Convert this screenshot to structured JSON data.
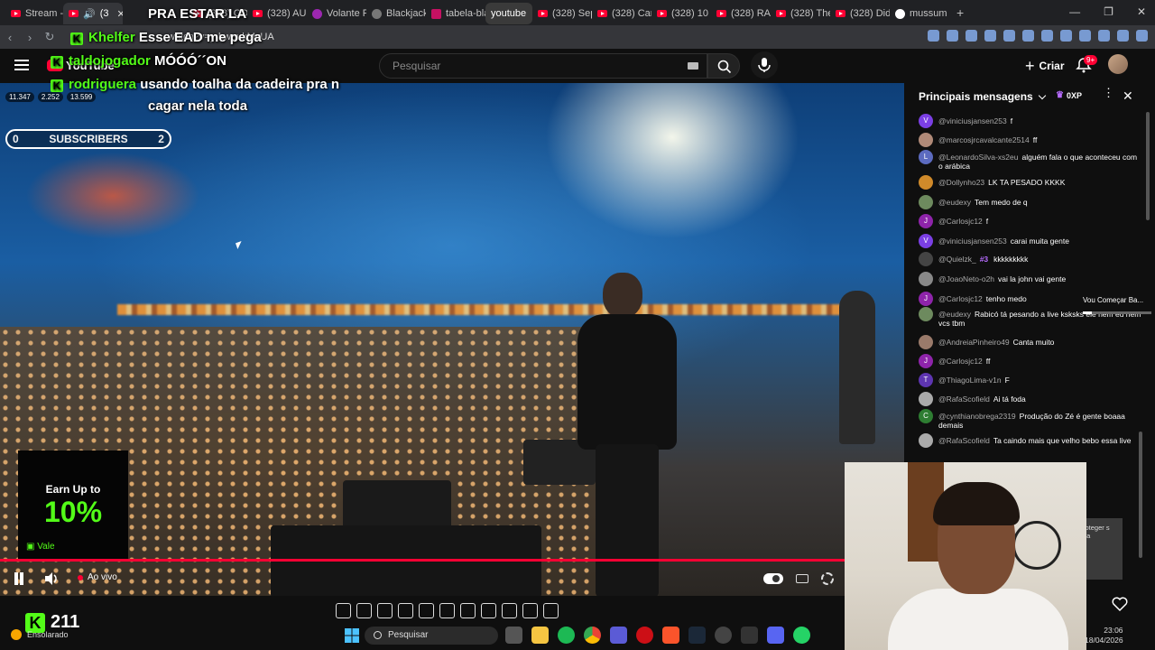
{
  "browser": {
    "tabs": [
      {
        "label": "Stream - K",
        "icon": "youtube-icon"
      },
      {
        "label": "(3",
        "icon": "youtube-icon",
        "active": true
      },
      {
        "label": "(328) CON",
        "icon": "youtube-icon"
      },
      {
        "label": "(328) AU",
        "icon": "youtube-icon"
      },
      {
        "label": "Volante F",
        "icon": "volante-icon"
      },
      {
        "label": "Blackjack",
        "icon": "blackjack-icon"
      },
      {
        "label": "tabela-bla",
        "icon": "doc-icon"
      },
      {
        "label": "youtube",
        "icon": "youtube-icon"
      },
      {
        "label": "(328) Sep",
        "icon": "youtube-icon"
      },
      {
        "label": "(328) Can",
        "icon": "youtube-icon"
      },
      {
        "label": "(328) 10 C",
        "icon": "youtube-icon"
      },
      {
        "label": "(328) RA",
        "icon": "youtube-icon"
      },
      {
        "label": "(328) The",
        "icon": "youtube-icon"
      },
      {
        "label": "(328) Did",
        "icon": "youtube-icon"
      },
      {
        "label": "mussum",
        "icon": "google-icon"
      }
    ],
    "url": "watch?v=y-bweukMvUA"
  },
  "youtube": {
    "logo_text": "YouTube",
    "search_placeholder": "Pesquisar",
    "create_label": "Criar",
    "notifications_badge": "9+"
  },
  "overlay": {
    "chat_lines": [
      {
        "user": "",
        "text": "PRA ESTAR LA"
      },
      {
        "user": "Khelfer",
        "text": "Esse EAD me pega"
      },
      {
        "user": "taldojogador",
        "text": "MÓÓÓ´´ON"
      },
      {
        "user": "rodriguera",
        "text": "usando toalha da cadeira pra n"
      },
      {
        "user": "",
        "text": "cagar nela toda"
      }
    ],
    "stats": [
      "11.347",
      "2.252",
      "13.599"
    ],
    "subs_left": "0",
    "subs_label": "SUBSCRIBERS",
    "subs_right": "2",
    "promo_top": "Earn Up to",
    "promo_pct": "10%",
    "promo_brand": "Vale"
  },
  "player": {
    "live_label": "Ao vivo",
    "progress": 1.0
  },
  "chat": {
    "header": "Principais mensagens",
    "xp_badge": "0XP",
    "messages": [
      {
        "user": "@viniciusjansen253",
        "text": "f",
        "avatar": "V",
        "color": "#7b3fe4"
      },
      {
        "user": "@marcosjrcavalcante2514",
        "text": "ff",
        "avatar": "",
        "color": "#b08a78"
      },
      {
        "user": "@LeonardoSilva-xs2eu",
        "text": "alguém fala o que aconteceu com o arábica",
        "avatar": "L",
        "color": "#5c6bc0"
      },
      {
        "user": "@Dollynho23",
        "text": "LK TA PESADO KKKK",
        "avatar": "",
        "color": "#d08a2a"
      },
      {
        "user": "@eudexy",
        "text": "Tem medo de q",
        "avatar": "",
        "color": "#6d8a5e"
      },
      {
        "user": "@Carlosjc12",
        "text": "f",
        "avatar": "J",
        "color": "#8e24aa"
      },
      {
        "user": "@viniciusjansen253",
        "text": "carai muita gente",
        "avatar": "V",
        "color": "#7b3fe4"
      },
      {
        "user": "@Quielzk_",
        "text": "kkkkkkkkk",
        "avatar": "",
        "color": "#444",
        "rank": "#3"
      },
      {
        "user": "@JoaoNeto-o2h",
        "text": "vai la john vai gente",
        "avatar": "",
        "color": "#888"
      },
      {
        "user": "@Carlosjc12",
        "text": "tenho medo",
        "avatar": "J",
        "color": "#8e24aa"
      },
      {
        "user": "@eudexy",
        "text": "Rabicó tá pesando a live ksksks ele nem eu nem vcs tbm",
        "avatar": "",
        "color": "#6d8a5e"
      },
      {
        "user": "@AndreiaPinheiro49",
        "text": "Canta muito",
        "avatar": "",
        "color": "#9a7a6a"
      },
      {
        "user": "@Carlosjc12",
        "text": "ff",
        "avatar": "J",
        "color": "#8e24aa"
      },
      {
        "user": "@ThiagoLima-v1n",
        "text": "F",
        "avatar": "T",
        "color": "#5e35b1"
      },
      {
        "user": "@RafaScofield",
        "text": "Ai tá foda",
        "avatar": "",
        "color": "#aaa"
      },
      {
        "user": "@cynthianobrega2319",
        "text": "Produção do Zé é gente boaaa demais",
        "avatar": "C",
        "color": "#2e7d32"
      },
      {
        "user": "@RafaScofield",
        "text": "Ta caindo mais que velho bebo essa live",
        "avatar": "",
        "color": "#aaa"
      }
    ],
    "side_preview": "Vou Começar Ba...",
    "tooltip": "roteger s da"
  },
  "taskbar": {
    "kick_viewers": "211",
    "weather": "Ensolarado",
    "search_placeholder": "Pesquisar",
    "time": "23:06",
    "date": "18/04/2026"
  }
}
